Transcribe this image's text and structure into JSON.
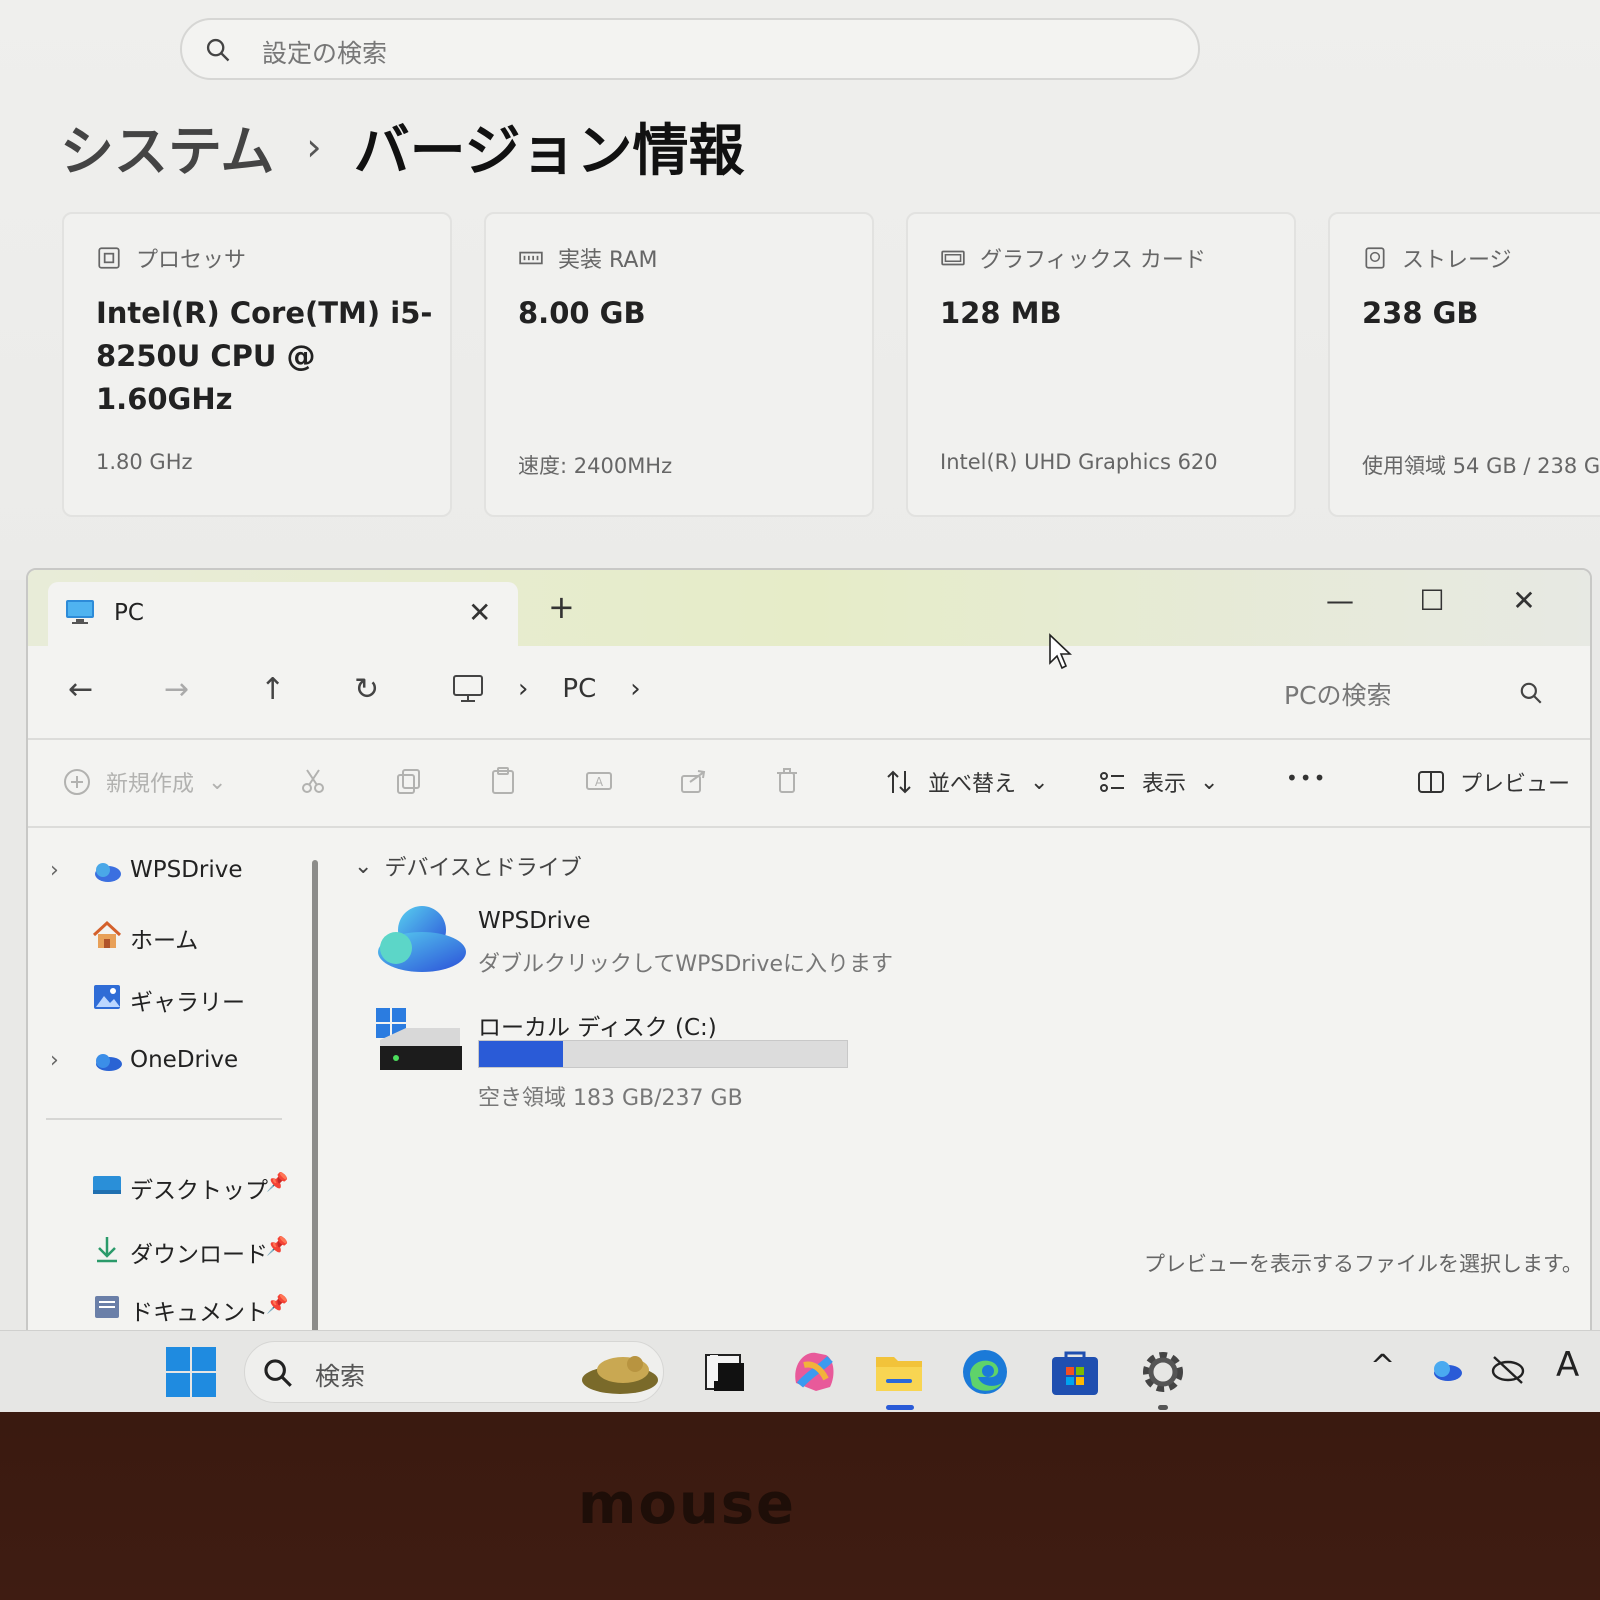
{
  "settings": {
    "search_placeholder": "設定の検索",
    "breadcrumb_parent": "システム",
    "breadcrumb_sep": "›",
    "breadcrumb_current": "バージョン情報",
    "specs": [
      {
        "label": "プロセッサ",
        "value": "Intel(R) Core(TM) i5-8250U CPU @ 1.60GHz",
        "sub": "1.80 GHz",
        "icon": "processor-icon"
      },
      {
        "label": "実装 RAM",
        "value": "8.00 GB",
        "sub": "速度: 2400MHz",
        "icon": "ram-icon"
      },
      {
        "label": "グラフィックス カード",
        "value": "128 MB",
        "sub": "Intel(R) UHD Graphics 620",
        "icon": "gpu-icon"
      },
      {
        "label": "ストレージ",
        "value": "238 GB",
        "sub": "使用領域 54 GB / 238 G",
        "icon": "storage-icon"
      }
    ]
  },
  "explorer": {
    "tab_title": "PC",
    "tab_close": "✕",
    "new_tab": "+",
    "controls": {
      "minimize": "—",
      "maximize": "☐",
      "close": "✕"
    },
    "nav": {
      "back": "←",
      "forward": "→",
      "up": "↑",
      "refresh": "↻"
    },
    "address": {
      "sep1": "›",
      "location": "PC",
      "sep2": "›"
    },
    "search_placeholder": "PCの検索",
    "toolbar": {
      "new": "新規作成",
      "sort": "並べ替え",
      "view": "表示",
      "more": "•••",
      "preview": "プレビュー"
    },
    "sidebar": [
      {
        "label": "WPSDrive",
        "chevron": "›",
        "icon": "cloud-icon"
      },
      {
        "label": "ホーム",
        "chevron": "",
        "icon": "home-icon"
      },
      {
        "label": "ギャラリー",
        "chevron": "",
        "icon": "gallery-icon"
      },
      {
        "label": "OneDrive",
        "chevron": "›",
        "icon": "onedrive-icon"
      },
      {
        "label": "デスクトップ",
        "pin": "📌",
        "icon": "desktop-folder-icon"
      },
      {
        "label": "ダウンロード",
        "pin": "📌",
        "icon": "download-icon"
      },
      {
        "label": "ドキュメント",
        "pin": "📌",
        "icon": "documents-icon"
      }
    ],
    "group_label": "デバイスとドライブ",
    "group_chevron": "⌄",
    "drives": [
      {
        "name": "WPSDrive",
        "desc": "ダブルクリックしてWPSDriveに入ります",
        "icon": "wpsdrive-cloud-icon"
      },
      {
        "name": "ローカル ディスク (C:)",
        "desc": "空き領域 183 GB/237 GB",
        "used_fraction": 0.228,
        "icon": "local-disk-icon"
      }
    ],
    "preview_message": "プレビューを表示するファイルを選択します。"
  },
  "taskbar": {
    "search_placeholder": "検索",
    "tray_chevron": "^",
    "ime": "A"
  },
  "bezel": {
    "brand": "mouse"
  },
  "colors": {
    "accent": "#2a5bd7",
    "bezel": "#3a1a10"
  }
}
